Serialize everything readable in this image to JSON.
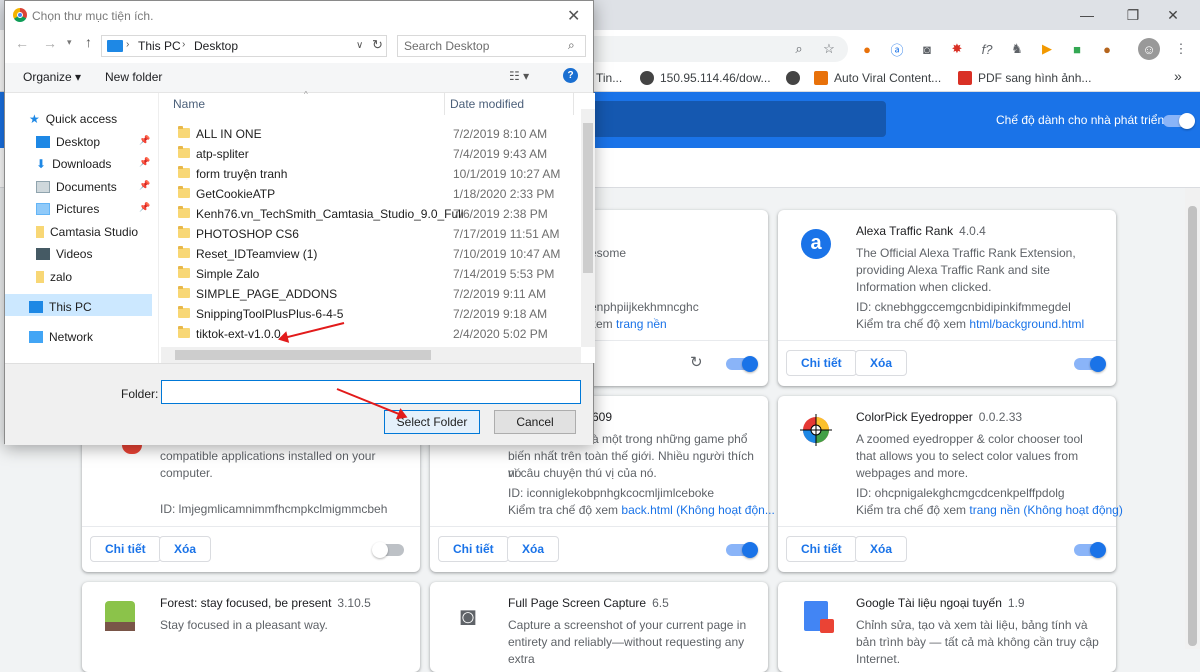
{
  "browser": {
    "toolbar_icons": [
      "zoom-icon",
      "star-icon"
    ],
    "bookmarks": [
      {
        "label": "Tin..."
      },
      {
        "label": "150.95.114.46/dow..."
      },
      {
        "label": "Auto Viral Content..."
      },
      {
        "label": "PDF sang hình ảnh..."
      }
    ],
    "bookmarks_more": "»"
  },
  "extensions_page": {
    "dev_mode_label": "Chế độ dành cho nhà phát triển",
    "details_label": "Chi tiết",
    "remove_label": "Xóa",
    "inspect_prefix": "Kiểm tra chế độ xem",
    "cards": [
      {
        "name_partial": "",
        "desc": "esome",
        "id": "enphpiijkekhmncghc",
        "inspect_link": "trang nền",
        "inspect_prefix": "xem"
      },
      {
        "name": "Alexa Traffic Rank",
        "version": "4.0.4",
        "desc": "The Official Alexa Traffic Rank Extension, providing Alexa Traffic Rank and site Information when clicked.",
        "id": "ID: cknebhggccemgcnbidipinkifmmegdel",
        "inspect_link": "html/background.html"
      },
      {
        "desc": "compatible applications installed on your computer.",
        "id": "ID: lmjegmlicamnimmfhcmpkclmigmmcbeh"
      },
      {
        "version": "609",
        "desc1": "à một trong những game phổ",
        "desc2": "biến nhất trên toàn thế giới. Nhiều người thích nó",
        "desc3": "vì câu chuyện thú vị của nó.",
        "id": "ID: iconniglekobpnhgkcocmljimlceboke",
        "inspect_link": "back.html (Không hoạt độn..."
      },
      {
        "name": "ColorPick Eyedropper",
        "version": "0.0.2.33",
        "desc": "A zoomed eyedropper & color chooser tool that allows you to select color values from webpages and more.",
        "id": "ID: ohcpnigalekghcmgcdcenkpelffpdolg",
        "inspect_link": "trang nền (Không hoạt động)"
      },
      {
        "name": "Forest: stay focused, be present",
        "version": "3.10.5",
        "desc": "Stay focused in a pleasant way."
      },
      {
        "name": "Full Page Screen Capture",
        "version": "6.5",
        "desc": "Capture a screenshot of your current page in entirety and reliably—without requesting any extra"
      },
      {
        "name": "Google Tài liệu ngoại tuyến",
        "version": "1.9",
        "desc": "Chỉnh sửa, tạo và xem tài liệu, bảng tính và bản trình bày — tất cả mà không cần truy cập Internet."
      }
    ]
  },
  "dialog": {
    "title": "Chọn thư mục tiện ích.",
    "breadcrumb": [
      "This PC",
      "Desktop"
    ],
    "search_placeholder": "Search Desktop",
    "organize_label": "Organize ▾",
    "new_folder_label": "New folder",
    "nav": [
      {
        "label": "Quick access"
      },
      {
        "label": "Desktop"
      },
      {
        "label": "Downloads"
      },
      {
        "label": "Documents"
      },
      {
        "label": "Pictures"
      },
      {
        "label": "Camtasia Studio"
      },
      {
        "label": "Videos"
      },
      {
        "label": "zalo"
      },
      {
        "label": "This PC"
      },
      {
        "label": "Network"
      }
    ],
    "columns": {
      "name": "Name",
      "date": "Date modified"
    },
    "files": [
      {
        "name": "ALL IN ONE",
        "date": "7/2/2019 8:10 AM"
      },
      {
        "name": "atp-spliter",
        "date": "7/4/2019 9:43 AM"
      },
      {
        "name": "form truyện tranh",
        "date": "10/1/2019 10:27 AM"
      },
      {
        "name": "GetCookieATP",
        "date": "1/18/2020 2:33 PM"
      },
      {
        "name": "Kenh76.vn_TechSmith_Camtasia_Studio_9.0_Full",
        "date": "7/6/2019 2:38 PM"
      },
      {
        "name": "PHOTOSHOP CS6",
        "date": "7/17/2019 11:51 AM"
      },
      {
        "name": "Reset_IDTeamview (1)",
        "date": "7/10/2019 10:47 AM"
      },
      {
        "name": "Simple Zalo",
        "date": "7/14/2019 5:53 PM"
      },
      {
        "name": "SIMPLE_PAGE_ADDONS",
        "date": "7/2/2019 9:11 AM"
      },
      {
        "name": "SnippingToolPlusPlus-6-4-5",
        "date": "7/2/2019 9:18 AM"
      },
      {
        "name": "tiktok-ext-v1.0.0",
        "date": "2/4/2020 5:02 PM"
      }
    ],
    "folder_label": "Folder:",
    "folder_value": "",
    "select_label": "Select Folder",
    "cancel_label": "Cancel"
  }
}
